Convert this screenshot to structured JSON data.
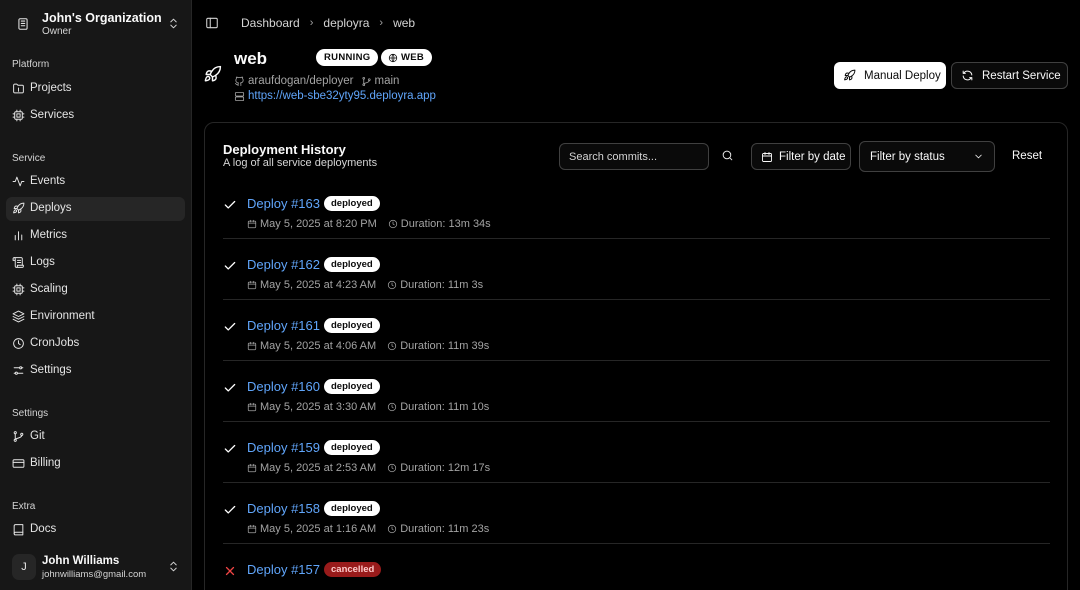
{
  "org": {
    "name": "John's Organization",
    "role": "Owner"
  },
  "sidebar": {
    "sections": {
      "platform": "Platform",
      "service": "Service",
      "settings": "Settings",
      "extra": "Extra"
    },
    "items": {
      "projects": "Projects",
      "services": "Services",
      "events": "Events",
      "deploys": "Deploys",
      "metrics": "Metrics",
      "logs": "Logs",
      "scaling": "Scaling",
      "environment": "Environment",
      "cronjobs": "CronJobs",
      "settings": "Settings",
      "git": "Git",
      "billing": "Billing",
      "docs": "Docs"
    },
    "active": "deploys"
  },
  "user": {
    "initial": "J",
    "name": "John Williams",
    "email": "johnwilliams@gmail.com"
  },
  "breadcrumb": [
    "Dashboard",
    "deployra",
    "web"
  ],
  "service": {
    "name": "web",
    "status": "RUNNING",
    "type": "WEB",
    "repo": "araufdogan/deployer",
    "branch": "main",
    "url": "https://web-sbe32yty95.deployra.app"
  },
  "actions": {
    "manual_deploy": "Manual Deploy",
    "restart": "Restart Service"
  },
  "history": {
    "title": "Deployment History",
    "subtitle": "A log of all service deployments",
    "search_placeholder": "Search commits...",
    "filter_date": "Filter by date",
    "filter_status": "Filter by status",
    "reset": "Reset",
    "deploys": [
      {
        "name": "Deploy #163",
        "status": "deployed",
        "date": "May 5, 2025 at 8:20 PM",
        "duration": "Duration: 13m 34s"
      },
      {
        "name": "Deploy #162",
        "status": "deployed",
        "date": "May 5, 2025 at 4:23 AM",
        "duration": "Duration: 11m 3s"
      },
      {
        "name": "Deploy #161",
        "status": "deployed",
        "date": "May 5, 2025 at 4:06 AM",
        "duration": "Duration: 11m 39s"
      },
      {
        "name": "Deploy #160",
        "status": "deployed",
        "date": "May 5, 2025 at 3:30 AM",
        "duration": "Duration: 11m 10s"
      },
      {
        "name": "Deploy #159",
        "status": "deployed",
        "date": "May 5, 2025 at 2:53 AM",
        "duration": "Duration: 12m 17s"
      },
      {
        "name": "Deploy #158",
        "status": "deployed",
        "date": "May 5, 2025 at 1:16 AM",
        "duration": "Duration: 11m 23s"
      },
      {
        "name": "Deploy #157",
        "status": "cancelled",
        "date": "",
        "duration": ""
      }
    ]
  },
  "colors": {
    "link": "#60a5fa",
    "success": "#ffffff",
    "error": "#ef4444",
    "cancelled_badge": "#991b1b"
  }
}
